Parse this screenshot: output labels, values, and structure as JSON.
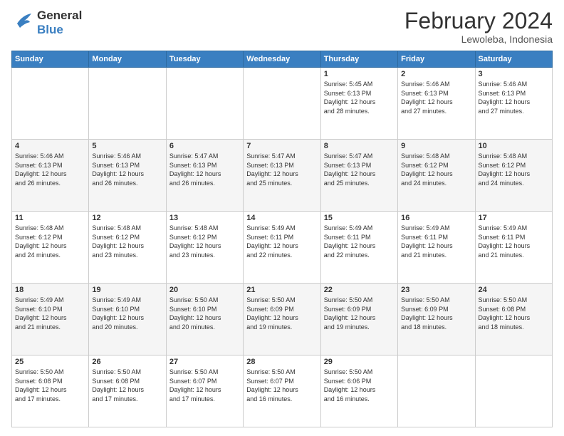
{
  "logo": {
    "general": "General",
    "blue": "Blue"
  },
  "title": {
    "month_year": "February 2024",
    "location": "Lewoleba, Indonesia"
  },
  "days_of_week": [
    "Sunday",
    "Monday",
    "Tuesday",
    "Wednesday",
    "Thursday",
    "Friday",
    "Saturday"
  ],
  "weeks": [
    {
      "shade": "white",
      "days": [
        {
          "num": "",
          "info": ""
        },
        {
          "num": "",
          "info": ""
        },
        {
          "num": "",
          "info": ""
        },
        {
          "num": "",
          "info": ""
        },
        {
          "num": "1",
          "info": "Sunrise: 5:45 AM\nSunset: 6:13 PM\nDaylight: 12 hours\nand 28 minutes."
        },
        {
          "num": "2",
          "info": "Sunrise: 5:46 AM\nSunset: 6:13 PM\nDaylight: 12 hours\nand 27 minutes."
        },
        {
          "num": "3",
          "info": "Sunrise: 5:46 AM\nSunset: 6:13 PM\nDaylight: 12 hours\nand 27 minutes."
        }
      ]
    },
    {
      "shade": "shade",
      "days": [
        {
          "num": "4",
          "info": "Sunrise: 5:46 AM\nSunset: 6:13 PM\nDaylight: 12 hours\nand 26 minutes."
        },
        {
          "num": "5",
          "info": "Sunrise: 5:46 AM\nSunset: 6:13 PM\nDaylight: 12 hours\nand 26 minutes."
        },
        {
          "num": "6",
          "info": "Sunrise: 5:47 AM\nSunset: 6:13 PM\nDaylight: 12 hours\nand 26 minutes."
        },
        {
          "num": "7",
          "info": "Sunrise: 5:47 AM\nSunset: 6:13 PM\nDaylight: 12 hours\nand 25 minutes."
        },
        {
          "num": "8",
          "info": "Sunrise: 5:47 AM\nSunset: 6:13 PM\nDaylight: 12 hours\nand 25 minutes."
        },
        {
          "num": "9",
          "info": "Sunrise: 5:48 AM\nSunset: 6:12 PM\nDaylight: 12 hours\nand 24 minutes."
        },
        {
          "num": "10",
          "info": "Sunrise: 5:48 AM\nSunset: 6:12 PM\nDaylight: 12 hours\nand 24 minutes."
        }
      ]
    },
    {
      "shade": "white",
      "days": [
        {
          "num": "11",
          "info": "Sunrise: 5:48 AM\nSunset: 6:12 PM\nDaylight: 12 hours\nand 24 minutes."
        },
        {
          "num": "12",
          "info": "Sunrise: 5:48 AM\nSunset: 6:12 PM\nDaylight: 12 hours\nand 23 minutes."
        },
        {
          "num": "13",
          "info": "Sunrise: 5:48 AM\nSunset: 6:12 PM\nDaylight: 12 hours\nand 23 minutes."
        },
        {
          "num": "14",
          "info": "Sunrise: 5:49 AM\nSunset: 6:11 PM\nDaylight: 12 hours\nand 22 minutes."
        },
        {
          "num": "15",
          "info": "Sunrise: 5:49 AM\nSunset: 6:11 PM\nDaylight: 12 hours\nand 22 minutes."
        },
        {
          "num": "16",
          "info": "Sunrise: 5:49 AM\nSunset: 6:11 PM\nDaylight: 12 hours\nand 21 minutes."
        },
        {
          "num": "17",
          "info": "Sunrise: 5:49 AM\nSunset: 6:11 PM\nDaylight: 12 hours\nand 21 minutes."
        }
      ]
    },
    {
      "shade": "shade",
      "days": [
        {
          "num": "18",
          "info": "Sunrise: 5:49 AM\nSunset: 6:10 PM\nDaylight: 12 hours\nand 21 minutes."
        },
        {
          "num": "19",
          "info": "Sunrise: 5:49 AM\nSunset: 6:10 PM\nDaylight: 12 hours\nand 20 minutes."
        },
        {
          "num": "20",
          "info": "Sunrise: 5:50 AM\nSunset: 6:10 PM\nDaylight: 12 hours\nand 20 minutes."
        },
        {
          "num": "21",
          "info": "Sunrise: 5:50 AM\nSunset: 6:09 PM\nDaylight: 12 hours\nand 19 minutes."
        },
        {
          "num": "22",
          "info": "Sunrise: 5:50 AM\nSunset: 6:09 PM\nDaylight: 12 hours\nand 19 minutes."
        },
        {
          "num": "23",
          "info": "Sunrise: 5:50 AM\nSunset: 6:09 PM\nDaylight: 12 hours\nand 18 minutes."
        },
        {
          "num": "24",
          "info": "Sunrise: 5:50 AM\nSunset: 6:08 PM\nDaylight: 12 hours\nand 18 minutes."
        }
      ]
    },
    {
      "shade": "white",
      "days": [
        {
          "num": "25",
          "info": "Sunrise: 5:50 AM\nSunset: 6:08 PM\nDaylight: 12 hours\nand 17 minutes."
        },
        {
          "num": "26",
          "info": "Sunrise: 5:50 AM\nSunset: 6:08 PM\nDaylight: 12 hours\nand 17 minutes."
        },
        {
          "num": "27",
          "info": "Sunrise: 5:50 AM\nSunset: 6:07 PM\nDaylight: 12 hours\nand 17 minutes."
        },
        {
          "num": "28",
          "info": "Sunrise: 5:50 AM\nSunset: 6:07 PM\nDaylight: 12 hours\nand 16 minutes."
        },
        {
          "num": "29",
          "info": "Sunrise: 5:50 AM\nSunset: 6:06 PM\nDaylight: 12 hours\nand 16 minutes."
        },
        {
          "num": "",
          "info": ""
        },
        {
          "num": "",
          "info": ""
        }
      ]
    }
  ]
}
